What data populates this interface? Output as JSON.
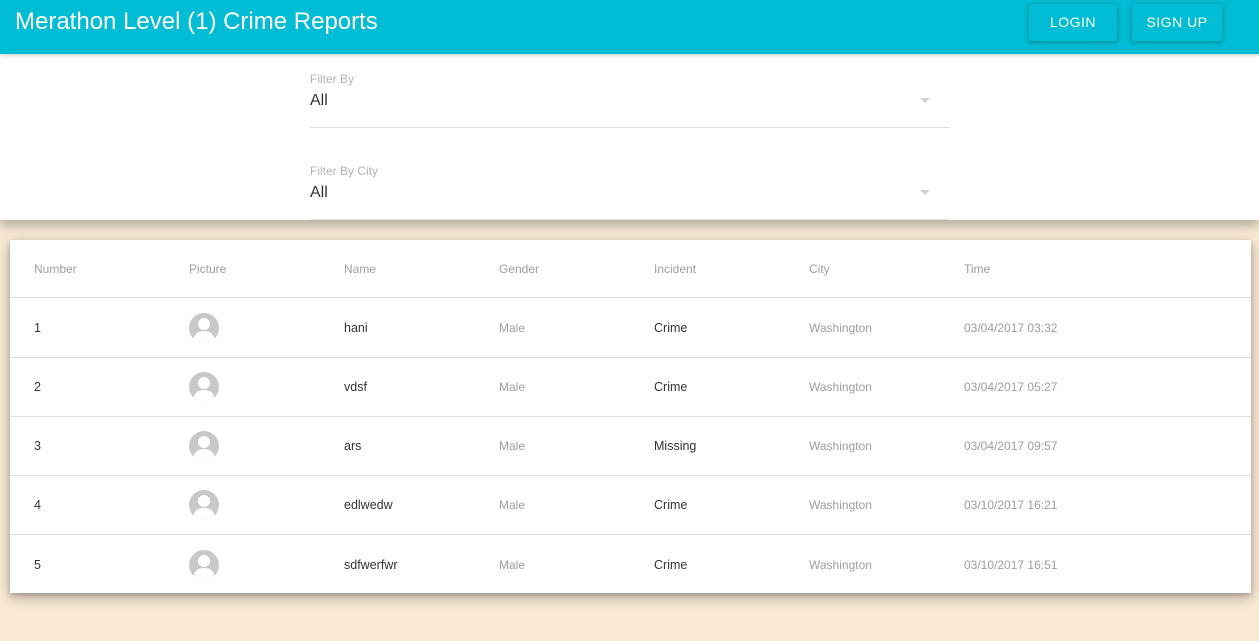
{
  "appbar": {
    "title": "Merathon Level (1) Crime Reports",
    "login_label": "LOGIN",
    "signup_label": "SIGN UP",
    "color": "#00bcd4"
  },
  "filters": {
    "filter_by": {
      "label": "Filter By",
      "value": "All"
    },
    "filter_by_city": {
      "label": "Filter By City",
      "value": "All"
    }
  },
  "table": {
    "headers": [
      "Number",
      "Picture",
      "Name",
      "Gender",
      "Incident",
      "City",
      "Time"
    ],
    "rows": [
      {
        "number": "1",
        "picture": "avatar-icon",
        "name": "hani",
        "gender": "Male",
        "incident": "Crime",
        "city": "Washington",
        "time": "03/04/2017 03:32"
      },
      {
        "number": "2",
        "picture": "avatar-icon",
        "name": "vdsf",
        "gender": "Male",
        "incident": "Crime",
        "city": "Washington",
        "time": "03/04/2017 05:27"
      },
      {
        "number": "3",
        "picture": "avatar-icon",
        "name": "ars",
        "gender": "Male",
        "incident": "Missing",
        "city": "Washington",
        "time": "03/04/2017 09:57"
      },
      {
        "number": "4",
        "picture": "avatar-icon",
        "name": "edlwedw",
        "gender": "Male",
        "incident": "Crime",
        "city": "Washington",
        "time": "03/10/2017 16:21"
      },
      {
        "number": "5",
        "picture": "avatar-icon",
        "name": "sdfwerfwr",
        "gender": "Male",
        "incident": "Crime",
        "city": "Washington",
        "time": "03/10/2017 16:51"
      }
    ]
  },
  "colors": {
    "accent": "#00bcd4",
    "background": "#f8e8d4"
  }
}
